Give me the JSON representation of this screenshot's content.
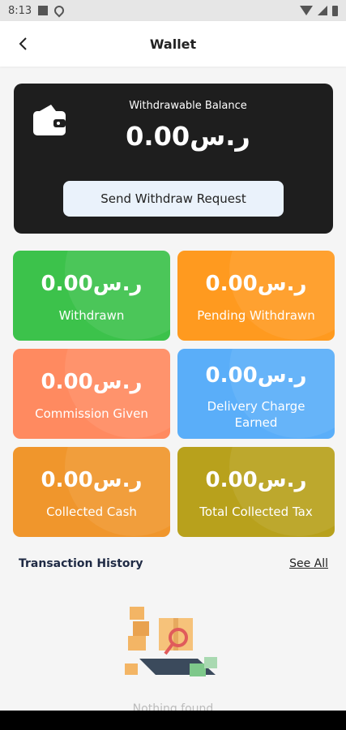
{
  "status_bar": {
    "time": "8:13"
  },
  "app_bar": {
    "title": "Wallet"
  },
  "balance_card": {
    "label": "Withdrawable Balance",
    "amount": "ر.س0.00",
    "button_label": "Send Withdraw Request"
  },
  "stats": [
    {
      "amount": "ر.س0.00",
      "label": "Withdrawn",
      "color": "#3cc24b"
    },
    {
      "amount": "ر.س0.00",
      "label": "Pending Withdrawn",
      "color": "#ff9a1f"
    },
    {
      "amount": "ر.س0.00",
      "label": "Commission Given",
      "color": "#ff8a60"
    },
    {
      "amount": "ر.س0.00",
      "label": "Delivery Charge Earned",
      "color": "#5aaef9"
    },
    {
      "amount": "ر.س0.00",
      "label": "Collected Cash",
      "color": "#f0962c"
    },
    {
      "amount": "ر.س0.00",
      "label": "Total Collected Tax",
      "color": "#b8a11c"
    }
  ],
  "transaction_history": {
    "title": "Transaction History",
    "see_all": "See All",
    "empty_text": "Nothing found"
  }
}
